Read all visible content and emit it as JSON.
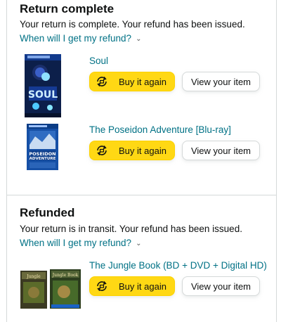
{
  "sections": [
    {
      "title": "Return complete",
      "description": "Your return is complete. Your refund has been issued.",
      "refund_link": "When will I get my refund?",
      "items": [
        {
          "title": "Soul",
          "buy_label": "Buy it again",
          "view_label": "View your item"
        },
        {
          "title": "The Poseidon Adventure [Blu-ray]",
          "buy_label": "Buy it again",
          "view_label": "View your item"
        }
      ]
    },
    {
      "title": "Refunded",
      "description": "Your return is in transit. Your refund has been issued.",
      "refund_link": "When will I get my refund?",
      "items": [
        {
          "title": "The Jungle Book (BD + DVD + Digital HD)",
          "buy_label": "Buy it again",
          "view_label": "View your item"
        }
      ]
    }
  ],
  "colors": {
    "link": "#007185",
    "buy_button": "#FFD814",
    "border": "#D5D9D9"
  },
  "icons": {
    "buy_again": "cart-rebuy-icon",
    "chevron": "chevron-down-icon"
  }
}
